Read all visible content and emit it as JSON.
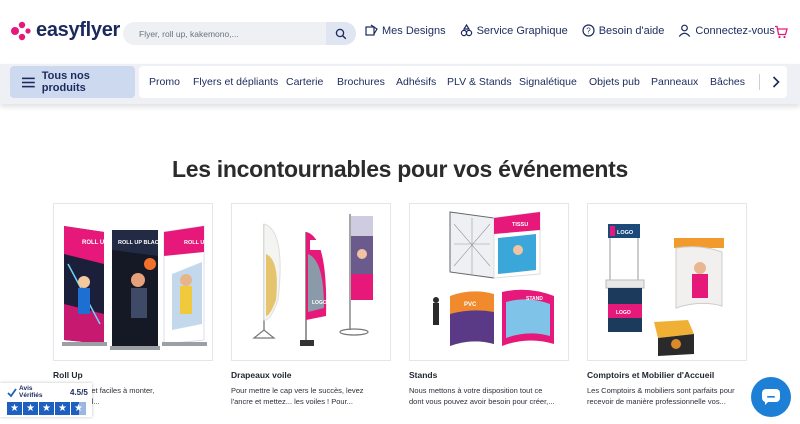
{
  "brand": {
    "name": "easyflyer"
  },
  "search": {
    "placeholder": "Flyer, roll up, kakemono,..."
  },
  "header_links": [
    {
      "label": "Mes Designs",
      "icon": "designs-icon"
    },
    {
      "label": "Service Graphique",
      "icon": "graphic-service-icon"
    },
    {
      "label": "Besoin d'aide",
      "icon": "help-icon"
    },
    {
      "label": "Connectez-vous",
      "icon": "user-icon"
    }
  ],
  "categories": {
    "all_label": "Tous nos produits",
    "items": [
      "Promo",
      "Flyers et dépliants",
      "Carterie",
      "Brochures",
      "Adhésifs",
      "PLV & Stands",
      "Signalétique",
      "Objets pub",
      "Panneaux",
      "Bâches"
    ]
  },
  "section": {
    "title": "Les incontournables pour vos événements"
  },
  "cards": [
    {
      "title": "Roll Up",
      "desc_line1": "transporter et faciles à monter,",
      "desc_line2": "sont un outil...",
      "img_text_1": "ROLL UP",
      "img_text_2": "ROLL UP BLACK",
      "img_text_3": "ROLL UP"
    },
    {
      "title": "Drapeaux voile",
      "desc_line1": "Pour mettre le cap vers le succès, levez",
      "desc_line2": "l'ancre et mettez... les voiles ! Pour...",
      "img_text_1": "LOGO"
    },
    {
      "title": "Stands",
      "desc_line1": "Nous mettons à votre disposition tout ce",
      "desc_line2": "dont vous pouvez avoir besoin pour créer,...",
      "img_text_1": "TISSU",
      "img_text_2": "PVC",
      "img_text_3": "STAND"
    },
    {
      "title": "Comptoirs et Mobilier d'Accueil",
      "desc_line1": "Les Comptoirs & mobiliers sont parfaits pour",
      "desc_line2": "recevoir de manière professionnelle vos...",
      "img_text_1": "LOGO",
      "img_text_2": "LOGO"
    }
  ],
  "avis": {
    "brand_line1": "Avis",
    "brand_line2": "Vérifiés",
    "score": "4.5/5",
    "stars": 4.5
  },
  "colors": {
    "brand_pink": "#e6197a",
    "navy": "#1b2a5c",
    "accent_blue": "#1e7fd6",
    "panel_bg": "#eef0f6"
  }
}
